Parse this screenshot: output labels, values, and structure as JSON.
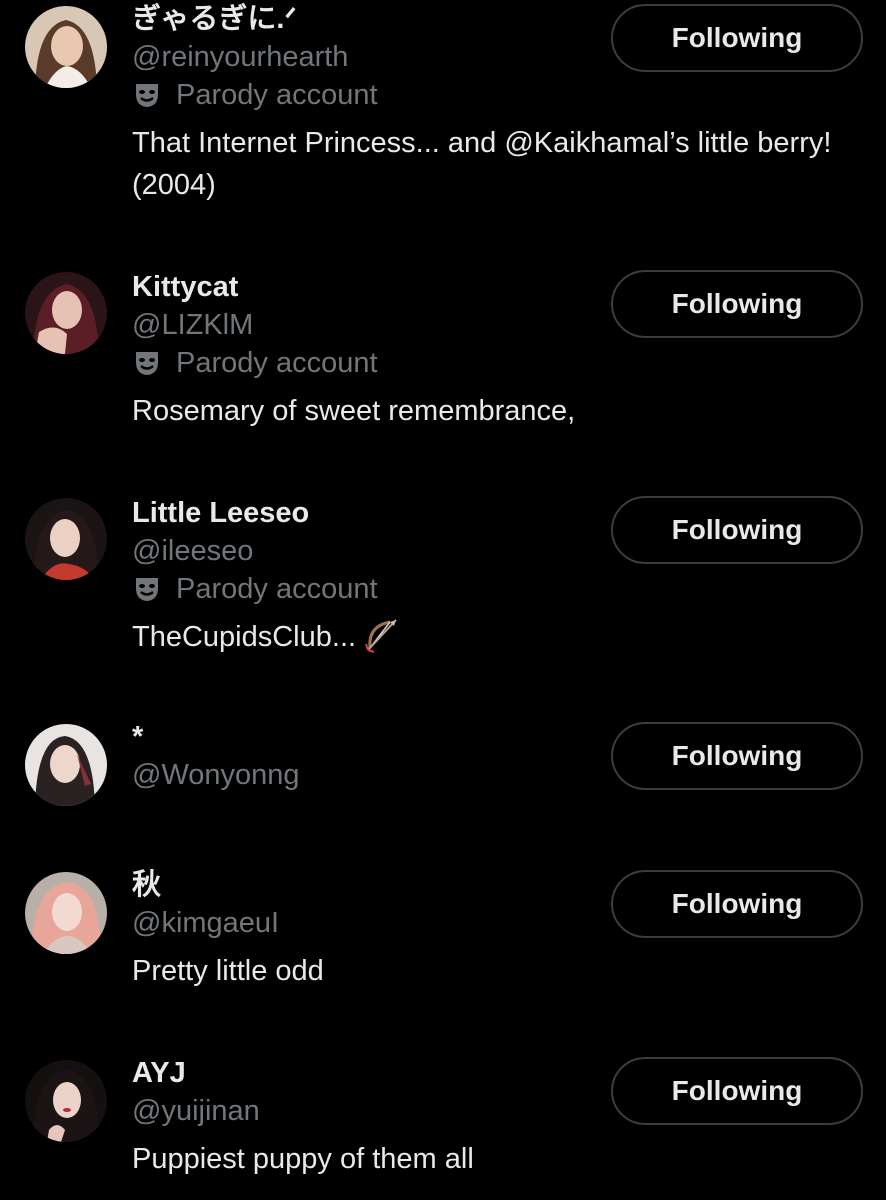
{
  "colors": {
    "background": "#000000",
    "primary_text": "#e7e9ea",
    "secondary_text": "#71767b",
    "button_border": "#3a3e42"
  },
  "users": [
    {
      "display_name": "ぎゃるぎに.ᐟ",
      "handle": "@reinyourhearth",
      "parody_label": "Parody account",
      "bio": "That Internet Princess... and @Kaikhamal’s little berry! (2004)",
      "button_label": "Following",
      "avatar_icon": "avatar-photo"
    },
    {
      "display_name": "Kittycat",
      "handle": "@LIZKlM",
      "parody_label": "Parody account",
      "bio": "Rosemary of sweet remembrance,",
      "button_label": "Following",
      "avatar_icon": "avatar-photo"
    },
    {
      "display_name": "Little Leeseo",
      "handle": "@ileeseo",
      "parody_label": "Parody account",
      "bio": "TheCupidsClub...",
      "bio_emoji": "bow-and-arrow-icon",
      "button_label": "Following",
      "avatar_icon": "avatar-photo"
    },
    {
      "display_name": "*",
      "handle": "@Wonyonng",
      "button_label": "Following",
      "avatar_icon": "avatar-photo"
    },
    {
      "display_name": "秋",
      "handle": "@kimgaeuI",
      "bio": "Pretty little odd",
      "button_label": "Following",
      "avatar_icon": "avatar-photo"
    },
    {
      "display_name": "AYJ",
      "handle": "@yuijinan",
      "bio": "Puppiest puppy of them all",
      "button_label": "Following",
      "avatar_icon": "avatar-photo"
    }
  ]
}
